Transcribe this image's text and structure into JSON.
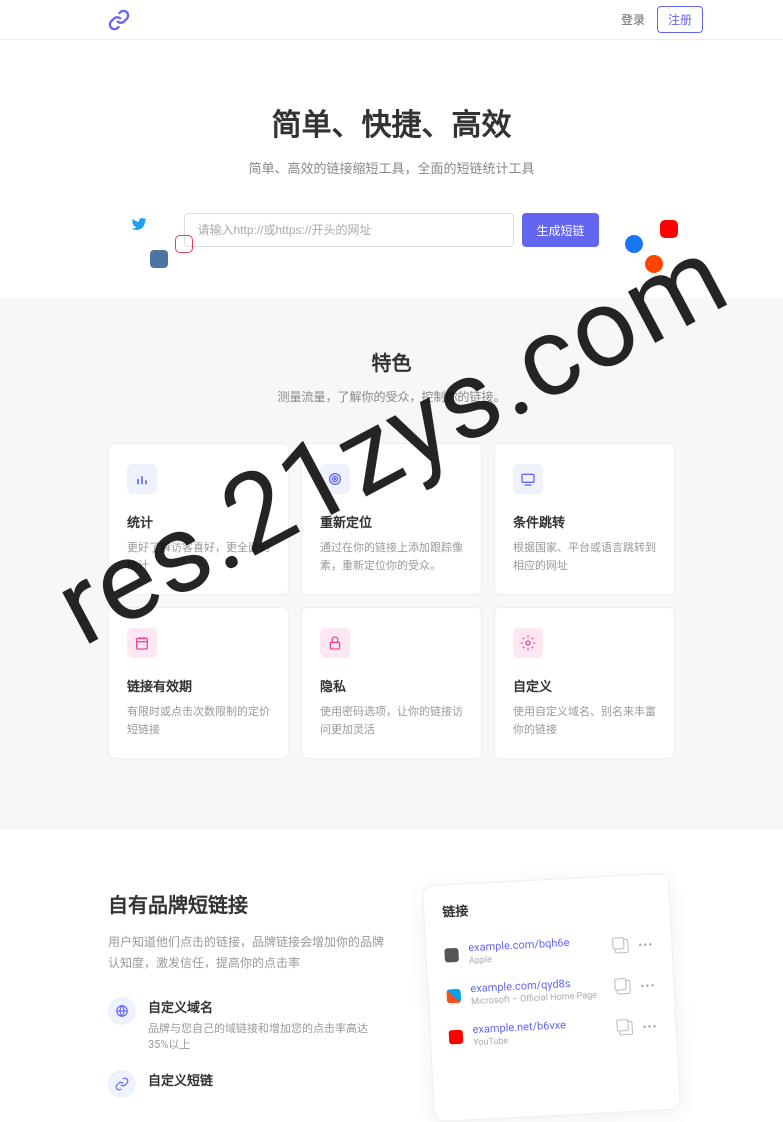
{
  "header": {
    "login_label": "登录",
    "signup_label": "注册"
  },
  "hero": {
    "title": "简单、快捷、高效",
    "subtitle": "简单、高效的链接缩短工具，全面的短链统计工具",
    "url_placeholder": "请输入http://或https://开头的网址",
    "shorten_label": "生成短链"
  },
  "features": {
    "title": "特色",
    "subtitle": "测量流量，了解你的受众，控制你的链接。",
    "items": [
      {
        "title": "统计",
        "desc": "更好了解访客喜好，更全面的统计",
        "color": "blue",
        "icon": "chart"
      },
      {
        "title": "重新定位",
        "desc": "通过在你的链接上添加跟踪像素，重新定位你的受众。",
        "color": "blue",
        "icon": "target"
      },
      {
        "title": "条件跳转",
        "desc": "根据国家、平台或语言跳转到相应的网址",
        "color": "blue",
        "icon": "screen"
      },
      {
        "title": "链接有效期",
        "desc": "有限时或点击次数限制的定价短链接",
        "color": "pink",
        "icon": "calendar"
      },
      {
        "title": "隐私",
        "desc": "使用密码选项，让你的链接访问更加灵活",
        "color": "pink",
        "icon": "lock"
      },
      {
        "title": "自定义",
        "desc": "使用自定义域名、别名来丰富你的链接",
        "color": "pink",
        "icon": "gear"
      }
    ]
  },
  "brand": {
    "title": "自有品牌短链接",
    "desc": "用户知道他们点击的链接，品牌链接会增加你的品牌认知度，激发信任，提高你的点击率",
    "features": [
      {
        "title": "自定义域名",
        "desc": "品牌与您自己的域链接和增加您的点击率高达35%以上"
      },
      {
        "title": "自定义短链",
        "desc": ""
      }
    ],
    "card": {
      "header": "链接",
      "links": [
        {
          "url": "example.com/bqh6e",
          "name": "Apple",
          "icon": "apple"
        },
        {
          "url": "example.com/qyd8s",
          "name": "Microsoft – Official Home Page",
          "icon": "ms"
        },
        {
          "url": "example.net/b6vxe",
          "name": "YouTube",
          "icon": "yt"
        }
      ]
    }
  },
  "watermark": "res.21zys.com"
}
